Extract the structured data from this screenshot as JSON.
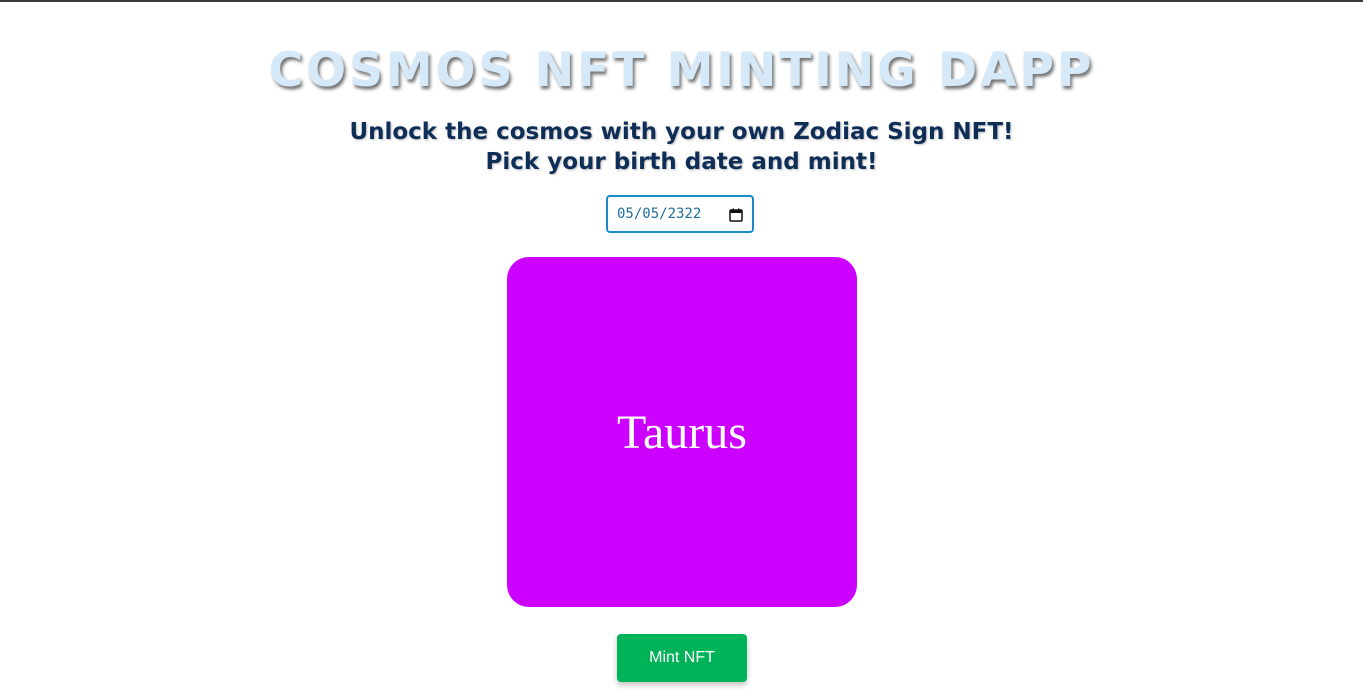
{
  "header": {
    "title": "COSMOS NFT MINTING DAPP",
    "subtitle_line1": "Unlock the cosmos with your own Zodiac Sign NFT!",
    "subtitle_line2": "Pick your birth date and mint!"
  },
  "date_picker": {
    "value": "05/05/2322",
    "icon": "calendar-icon"
  },
  "nft_card": {
    "sign": "Taurus",
    "background_color": "#cc00ff"
  },
  "mint": {
    "label": "Mint NFT",
    "color": "#00b359"
  }
}
